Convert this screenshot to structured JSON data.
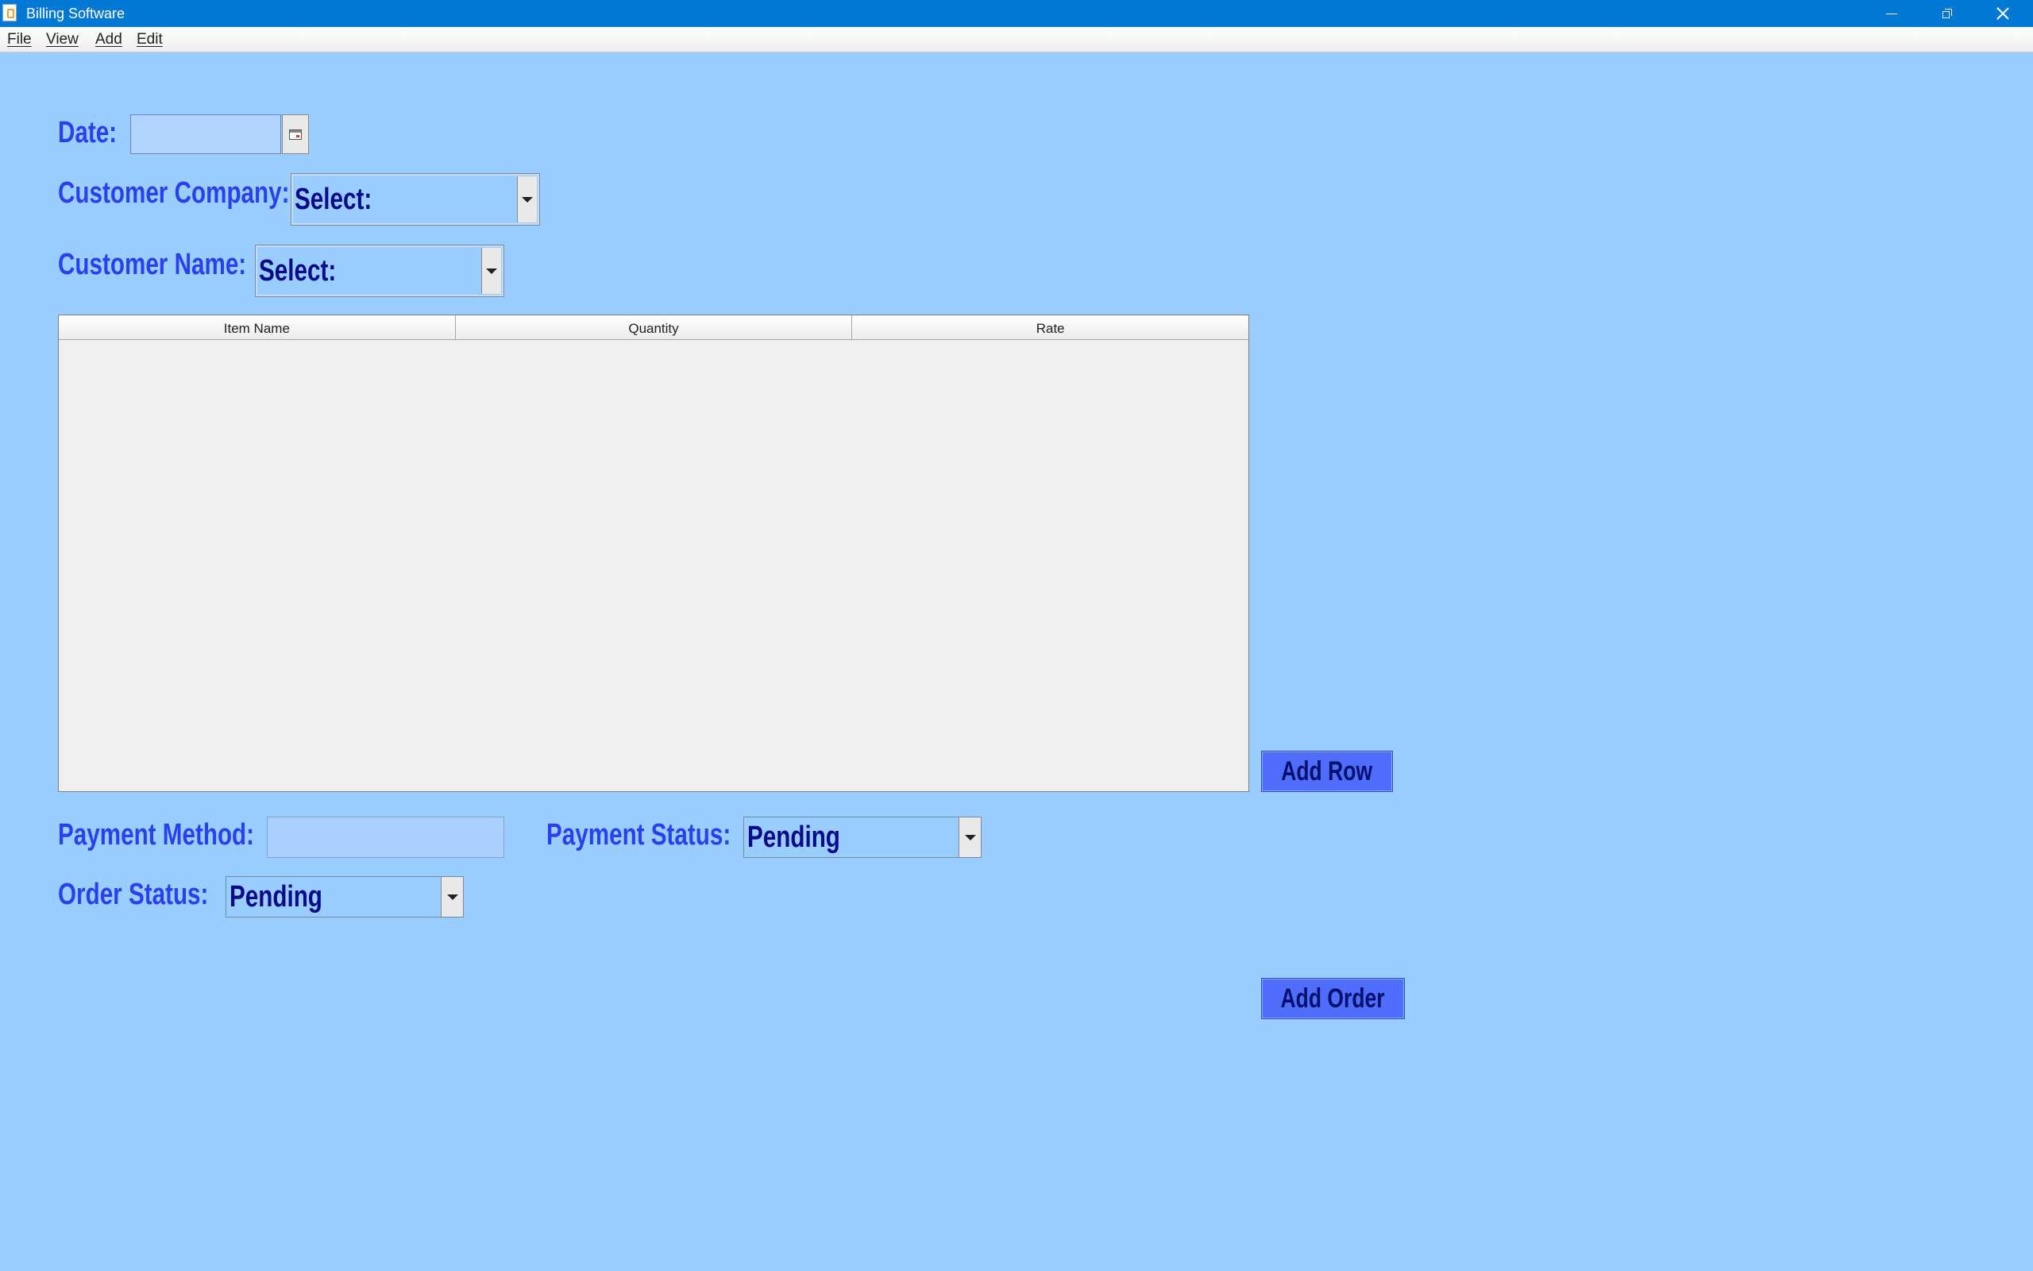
{
  "window": {
    "title": "Billing Software",
    "buttons": [
      "minimize",
      "maximize",
      "close"
    ]
  },
  "menu": {
    "items": [
      "File",
      "View",
      "Add",
      "Edit"
    ]
  },
  "form": {
    "date_label": "Date:",
    "date_value": "",
    "customer_company_label": "Customer Company:",
    "customer_company_value": "Select:",
    "customer_name_label": "Customer Name:",
    "customer_name_value": "Select:",
    "payment_method_label": "Payment Method:",
    "payment_method_value": "",
    "payment_status_label": "Payment Status:",
    "payment_status_value": "Pending",
    "order_status_label": "Order Status:",
    "order_status_value": "Pending"
  },
  "table": {
    "columns": [
      "Item Name",
      "Quantity",
      "Rate"
    ],
    "rows": []
  },
  "actions": {
    "add_row": "Add Row",
    "add_order": "Add Order"
  },
  "icons": {
    "calendar": "calendar-icon",
    "dropdown": "chevron-down-icon"
  },
  "colors": {
    "background": "#99ccff",
    "title_bar": "#0078d4",
    "label_text": "#2a3ff0",
    "button": "#4d6dfa"
  }
}
